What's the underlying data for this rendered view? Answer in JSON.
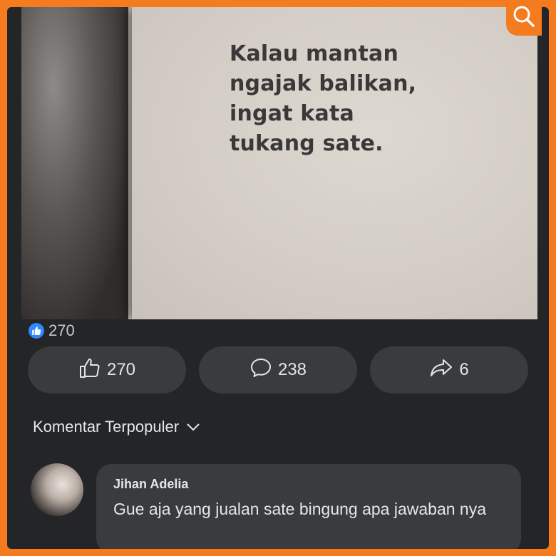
{
  "post": {
    "quote": "Kalau mantan\nngajak balikan,\ningat kata\ntukang sate."
  },
  "reactions": {
    "count": "270"
  },
  "actions": {
    "like": "270",
    "comment": "238",
    "share": "6"
  },
  "comments_section": {
    "sort_label": "Komentar Terpopuler"
  },
  "comments": [
    {
      "author": "Jihan Adelia",
      "text": "Gue aja yang jualan sate bingung apa jawaban nya"
    }
  ],
  "colors": {
    "frame_border": "#f47c1e",
    "background": "#242526",
    "button": "#3a3b3c",
    "like_blue": "#2e89ff",
    "text": "#e4e6eb"
  },
  "icons": [
    "search-icon",
    "like-reaction-icon",
    "thumbs-up-icon",
    "comment-icon",
    "share-icon",
    "chevron-down-icon"
  ]
}
